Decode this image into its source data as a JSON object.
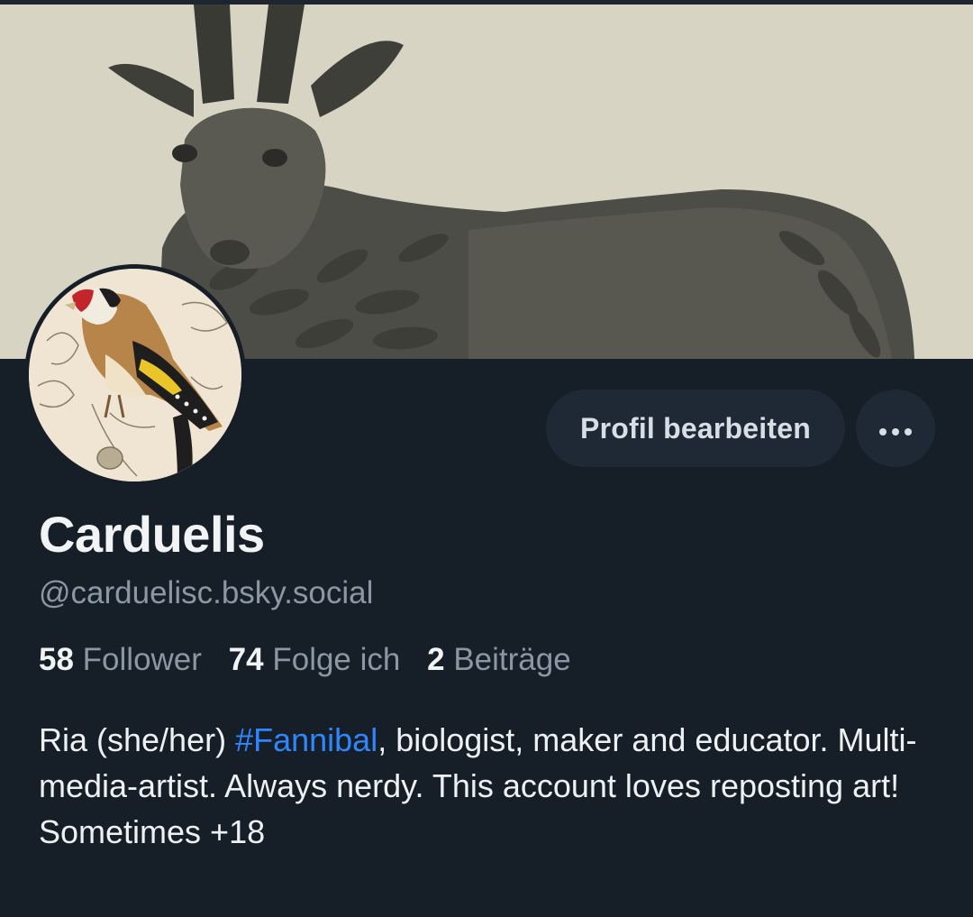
{
  "profile": {
    "display_name": "Carduelis",
    "handle": "@carduelisc.bsky.social",
    "edit_label": "Profil bearbeiten",
    "more_label": "•••",
    "stats": {
      "followers_count": "58",
      "followers_label": "Follower",
      "following_count": "74",
      "following_label": "Folge ich",
      "posts_count": "2",
      "posts_label": "Beiträge"
    },
    "bio": {
      "before_tag": "Ria (she/her) ",
      "hashtag": "#Fannibal",
      "after_tag": ", biologist, maker and educator. Multi-media-artist. Always nerdy.  This account loves reposting art! Sometimes +18"
    }
  },
  "colors": {
    "background": "#161e27",
    "button_background": "#1f2935",
    "accent_link": "#2f86ff",
    "muted_text": "#8c97a6",
    "primary_text": "#f1f3f5"
  },
  "icons": {
    "more": "ellipsis-icon"
  }
}
